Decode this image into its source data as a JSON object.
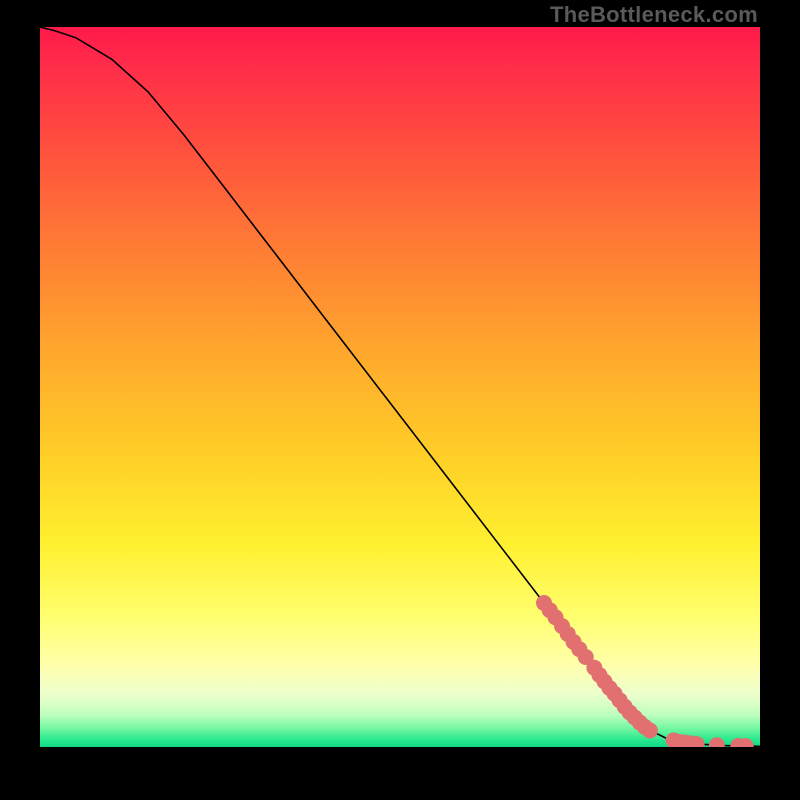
{
  "watermark": "TheBottleneck.com",
  "chart_data": {
    "type": "line",
    "title": "",
    "xlabel": "",
    "ylabel": "",
    "xlim": [
      0,
      100
    ],
    "ylim": [
      0,
      100
    ],
    "grid": false,
    "legend": false,
    "curve": {
      "name": "main-line",
      "color": "#000000",
      "points": [
        {
          "x": 0,
          "y": 100
        },
        {
          "x": 2,
          "y": 99.5
        },
        {
          "x": 5,
          "y": 98.5
        },
        {
          "x": 10,
          "y": 95.5
        },
        {
          "x": 15,
          "y": 91
        },
        {
          "x": 20,
          "y": 85
        },
        {
          "x": 25,
          "y": 78.5
        },
        {
          "x": 30,
          "y": 72
        },
        {
          "x": 40,
          "y": 59
        },
        {
          "x": 50,
          "y": 46
        },
        {
          "x": 60,
          "y": 33
        },
        {
          "x": 70,
          "y": 20
        },
        {
          "x": 75,
          "y": 13.5
        },
        {
          "x": 80,
          "y": 7.5
        },
        {
          "x": 82,
          "y": 5.0
        },
        {
          "x": 85,
          "y": 2.2
        },
        {
          "x": 87,
          "y": 1.2
        },
        {
          "x": 90,
          "y": 0.5
        },
        {
          "x": 95,
          "y": 0.2
        },
        {
          "x": 100,
          "y": 0.1
        }
      ]
    },
    "highlight_points": {
      "name": "marker-cluster",
      "color": "#e27070",
      "radius": 8,
      "xy": [
        [
          70.0,
          20.0
        ],
        [
          70.8,
          19.0
        ],
        [
          71.6,
          18.0
        ],
        [
          72.5,
          16.8
        ],
        [
          73.3,
          15.7
        ],
        [
          74.1,
          14.6
        ],
        [
          74.9,
          13.6
        ],
        [
          75.8,
          12.5
        ],
        [
          77.0,
          11.0
        ],
        [
          77.7,
          10.0
        ],
        [
          78.4,
          9.1
        ],
        [
          79.1,
          8.2
        ],
        [
          79.8,
          7.4
        ],
        [
          80.5,
          6.5
        ],
        [
          81.2,
          5.6
        ],
        [
          81.9,
          4.8
        ],
        [
          82.6,
          4.1
        ],
        [
          83.3,
          3.4
        ],
        [
          84.0,
          2.8
        ],
        [
          84.7,
          2.3
        ],
        [
          88.0,
          0.9
        ],
        [
          88.8,
          0.7
        ],
        [
          89.6,
          0.6
        ],
        [
          90.4,
          0.5
        ],
        [
          91.2,
          0.4
        ],
        [
          94.0,
          0.25
        ],
        [
          97.0,
          0.15
        ],
        [
          98.0,
          0.12
        ]
      ]
    },
    "gradient": {
      "description": "vertical rainbow, red at top through orange/yellow to thin green band at very bottom",
      "stops": [
        {
          "offset": 0,
          "color": "#ff1a4a"
        },
        {
          "offset": 0.05,
          "color": "#ff2b4a"
        },
        {
          "offset": 0.15,
          "color": "#ff4a3f"
        },
        {
          "offset": 0.3,
          "color": "#ff7a35"
        },
        {
          "offset": 0.45,
          "color": "#ffa72d"
        },
        {
          "offset": 0.6,
          "color": "#ffd027"
        },
        {
          "offset": 0.72,
          "color": "#fff030"
        },
        {
          "offset": 0.82,
          "color": "#ffff70"
        },
        {
          "offset": 0.885,
          "color": "#ffffaa"
        },
        {
          "offset": 0.925,
          "color": "#eeffcc"
        },
        {
          "offset": 0.955,
          "color": "#bfffbf"
        },
        {
          "offset": 0.975,
          "color": "#70f7a0"
        },
        {
          "offset": 0.99,
          "color": "#28e88f"
        },
        {
          "offset": 1.0,
          "color": "#10d885"
        }
      ]
    }
  }
}
